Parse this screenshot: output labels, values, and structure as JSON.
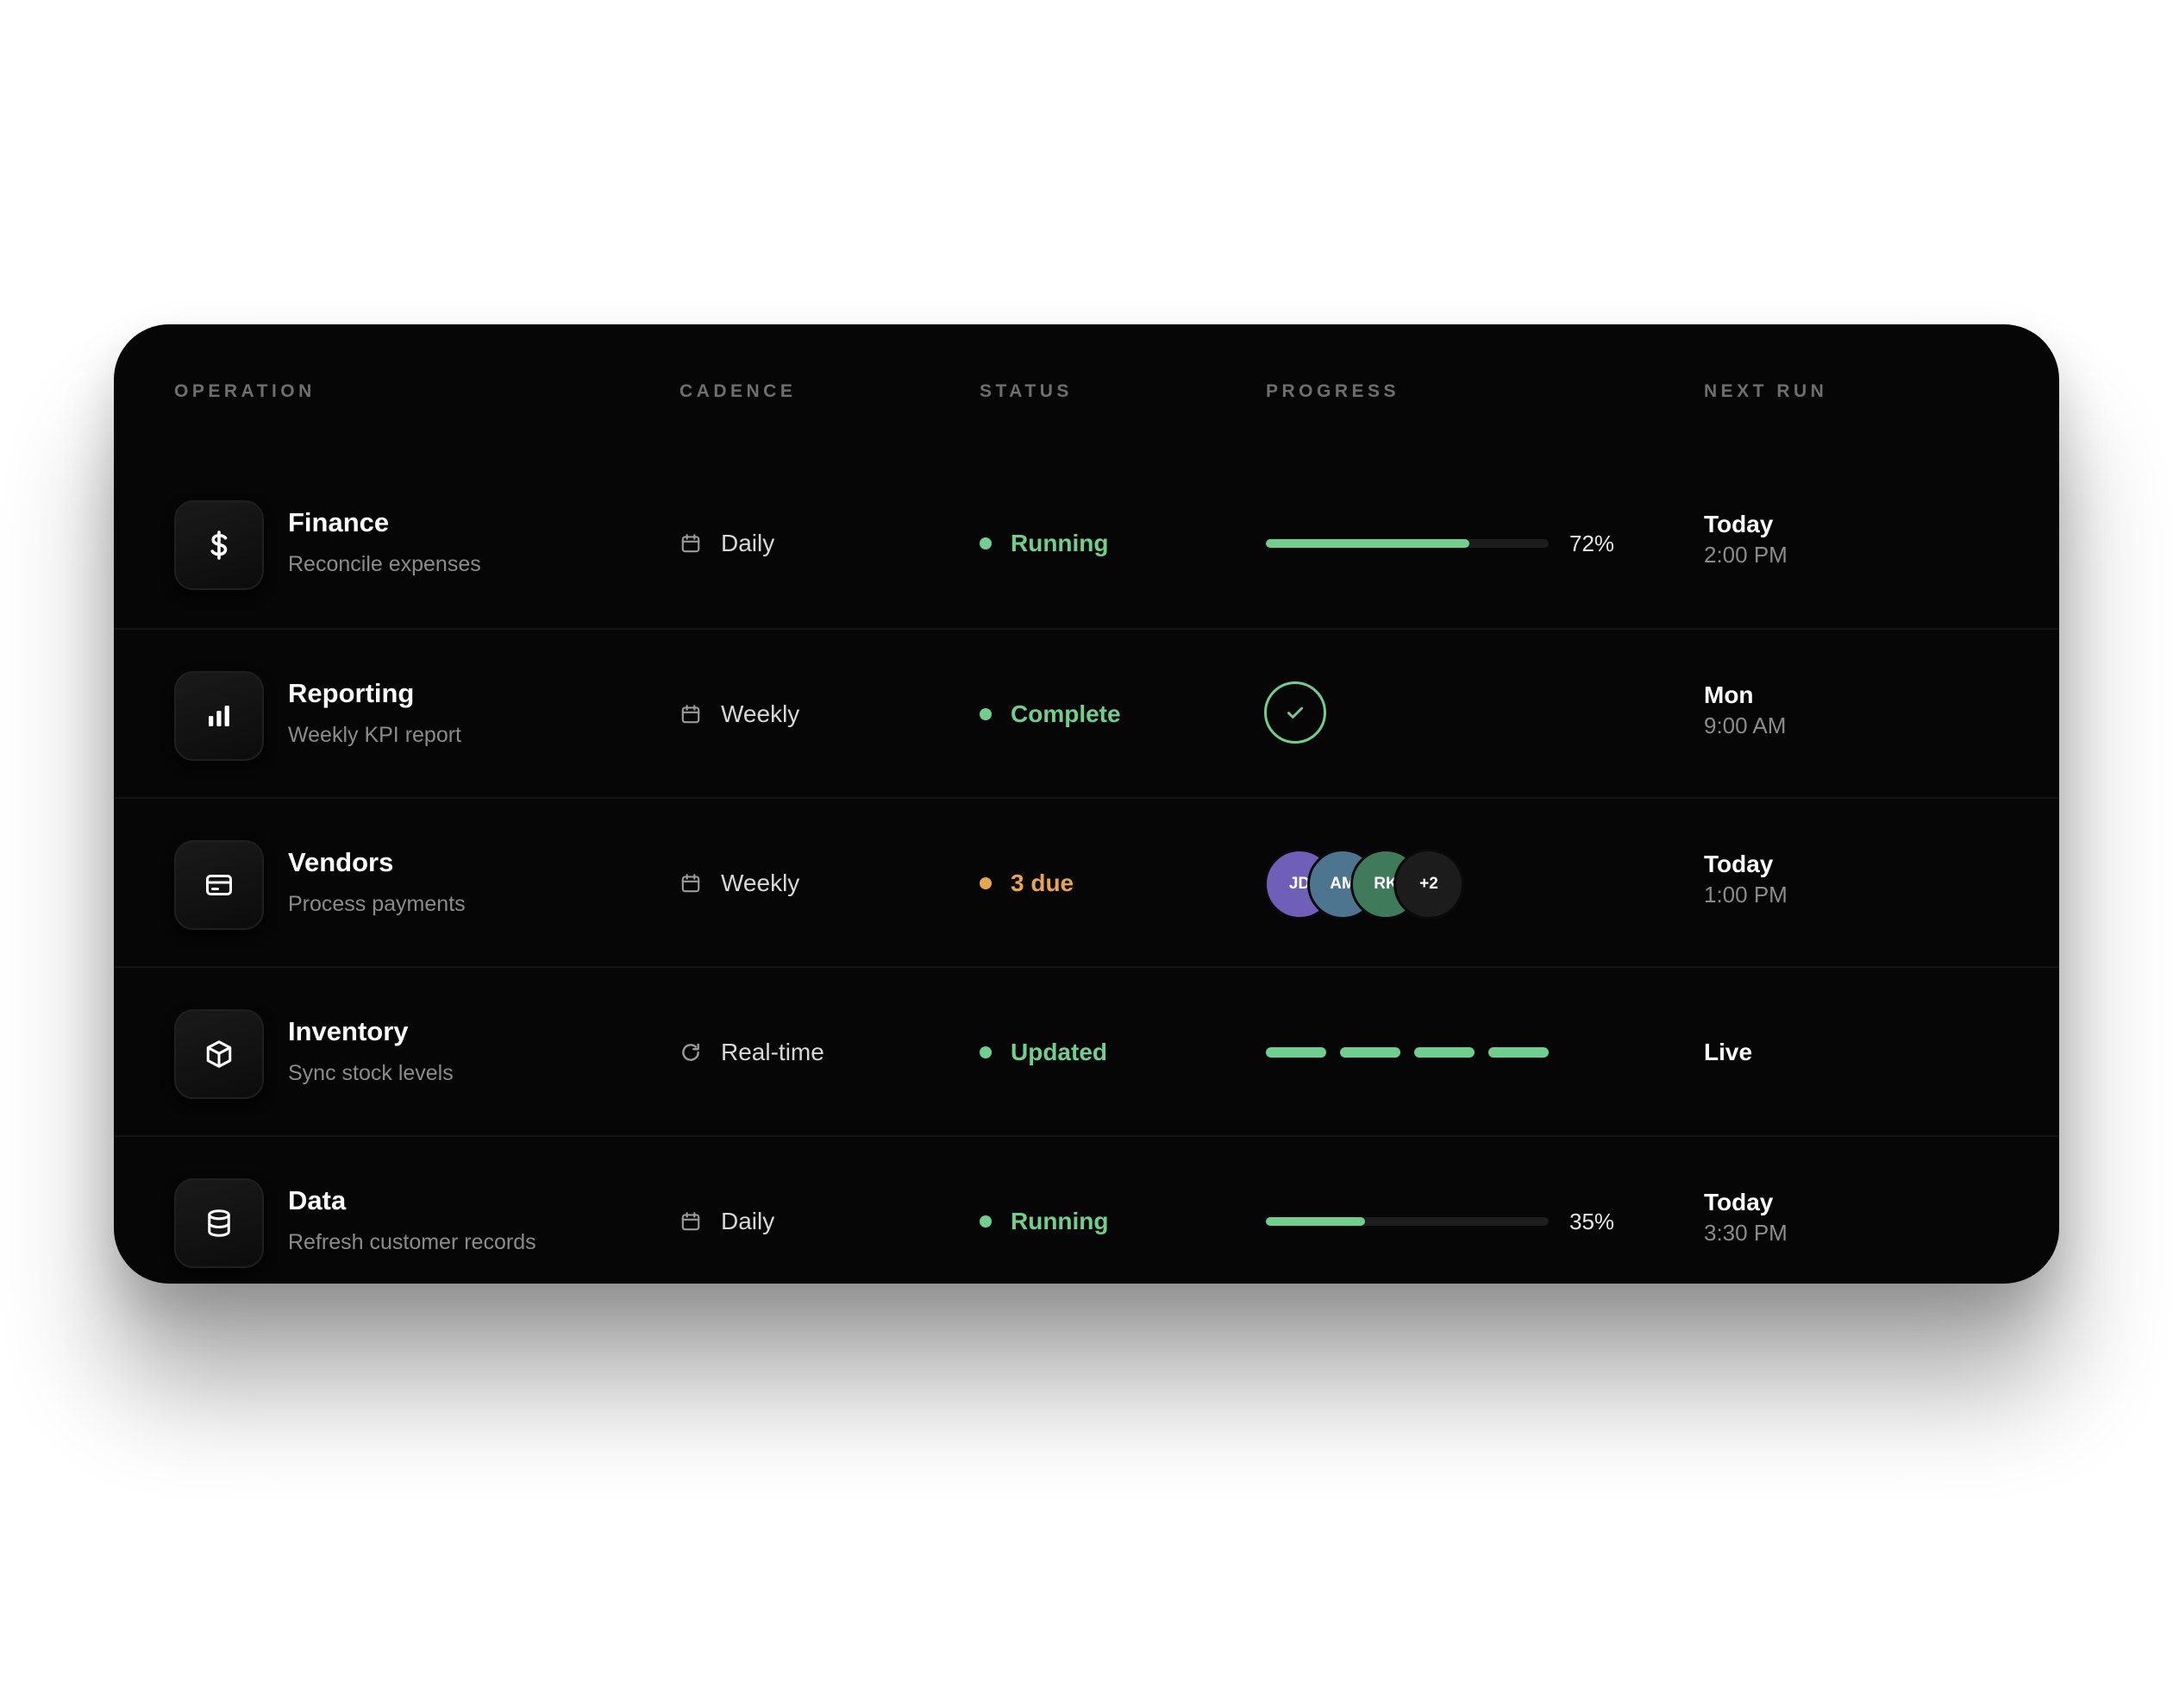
{
  "columns": {
    "operation": "OPERATION",
    "cadence": "CADENCE",
    "status": "STATUS",
    "progress": "PROGRESS",
    "next_run": "NEXT RUN"
  },
  "colors": {
    "accent_green": "#6fcf8c",
    "accent_orange": "#e8a54b",
    "card_bg": "#060606"
  },
  "rows": [
    {
      "icon": "dollar-icon",
      "title": "Finance",
      "subtitle": "Reconcile expenses",
      "cadence_icon": "calendar-icon",
      "cadence": "Daily",
      "status": "Running",
      "status_color": "#6fcf8c",
      "progress_type": "bar",
      "progress": 0.72,
      "progress_label": "72%",
      "next_main": "Today",
      "next_sub": "2:00 PM"
    },
    {
      "icon": "bar-chart-icon",
      "title": "Reporting",
      "subtitle": "Weekly KPI report",
      "cadence_icon": "calendar-icon",
      "cadence": "Weekly",
      "status": "Complete",
      "status_color": "#6fcf8c",
      "progress_type": "check",
      "next_main": "Mon",
      "next_sub": "9:00 AM"
    },
    {
      "icon": "credit-card-icon",
      "title": "Vendors",
      "subtitle": "Process payments",
      "cadence_icon": "calendar-icon",
      "cadence": "Weekly",
      "status": "3 due",
      "status_color": "#e8a54b",
      "progress_type": "avatars",
      "avatars": [
        {
          "initials": "JD",
          "color": "#6f5fb8"
        },
        {
          "initials": "AM",
          "color": "#4d7590"
        },
        {
          "initials": "RK",
          "color": "#3f7a5a"
        },
        {
          "initials": "+2",
          "color": "#1c1c1c"
        }
      ],
      "next_main": "Today",
      "next_sub": "1:00 PM"
    },
    {
      "icon": "cube-icon",
      "title": "Inventory",
      "subtitle": "Sync stock levels",
      "cadence_icon": "refresh-icon",
      "cadence": "Real-time",
      "status": "Updated",
      "status_color": "#6fcf8c",
      "progress_type": "segments",
      "segments": 4,
      "next_main": "Live",
      "next_sub": ""
    },
    {
      "icon": "database-icon",
      "title": "Data",
      "subtitle": "Refresh customer records",
      "cadence_icon": "calendar-icon",
      "cadence": "Daily",
      "status": "Running",
      "status_color": "#6fcf8c",
      "progress_type": "bar",
      "progress": 0.35,
      "progress_label": "35%",
      "next_main": "Today",
      "next_sub": "3:30 PM"
    }
  ]
}
